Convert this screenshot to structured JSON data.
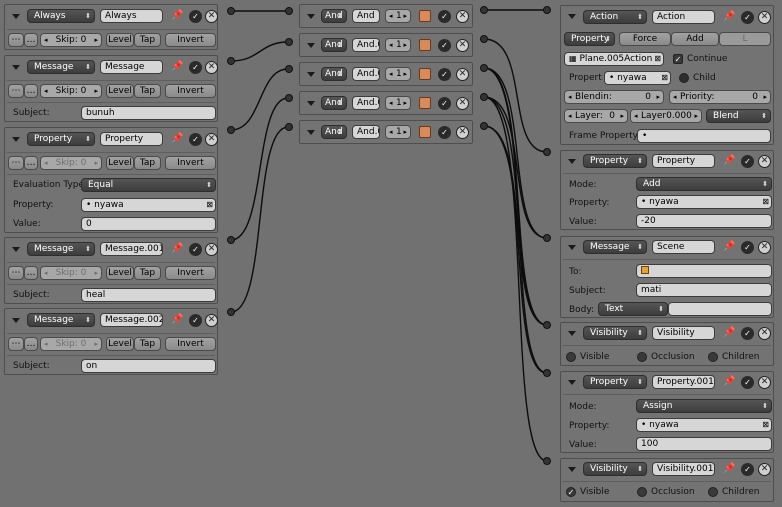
{
  "sensors": [
    {
      "type": "Always",
      "name": "Always",
      "skip_label": "Skip:",
      "skip_value": "0",
      "level": "Level",
      "tap": "Tap",
      "invert": "Invert"
    },
    {
      "type": "Message",
      "name": "Message",
      "skip_label": "Skip:",
      "skip_value": "0",
      "level": "Level",
      "tap": "Tap",
      "invert": "Invert",
      "subject_label": "Subject:",
      "subject": "bunuh"
    },
    {
      "type": "Property",
      "name": "Property",
      "skip_label": "Skip:",
      "skip_value": "0",
      "level": "Level",
      "tap": "Tap",
      "invert": "Invert",
      "eval_label": "Evaluation Type:",
      "eval": "Equal",
      "prop_label": "Property:",
      "prop": "nyawa",
      "value_label": "Value:",
      "value": "0"
    },
    {
      "type": "Message",
      "name": "Message.001",
      "skip_label": "Skip:",
      "skip_value": "0",
      "level": "Level",
      "tap": "Tap",
      "invert": "Invert",
      "subject_label": "Subject:",
      "subject": "heal"
    },
    {
      "type": "Message",
      "name": "Message.002",
      "skip_label": "Skip:",
      "skip_value": "0",
      "level": "Level",
      "tap": "Tap",
      "invert": "Invert",
      "subject_label": "Subject:",
      "subject": "on"
    }
  ],
  "controllers": [
    {
      "type": "And",
      "name": "And",
      "state": "1"
    },
    {
      "type": "And",
      "name": "And.0",
      "state": "1"
    },
    {
      "type": "And",
      "name": "And.0",
      "state": "1"
    },
    {
      "type": "And",
      "name": "And.0",
      "state": "1"
    },
    {
      "type": "And",
      "name": "And.0",
      "state": "1"
    }
  ],
  "actuators": {
    "action": {
      "type": "Action",
      "name": "Action",
      "mode": "Property",
      "force": "Force",
      "add": "Add",
      "l": "L",
      "action_name": "Plane.005Action",
      "continue": "Continue",
      "prop_label": "Propert",
      "prop": "nyawa",
      "child": "Child",
      "blendin_label": "Blendin:",
      "blendin": "0",
      "priority_label": "Priority:",
      "priority": "0",
      "layer_label": "Layer:",
      "layer": "0",
      "layer_weight": "Layer0.000",
      "blend": "Blend",
      "frame_prop_label": "Frame Property:"
    },
    "property1": {
      "type": "Property",
      "name": "Property",
      "mode_label": "Mode:",
      "mode": "Add",
      "prop_label": "Property:",
      "prop": "nyawa",
      "value_label": "Value:",
      "value": "-20"
    },
    "message": {
      "type": "Message",
      "name": "Scene",
      "to_label": "To:",
      "subject_label": "Subject:",
      "subject": "mati",
      "body_label": "Body:",
      "body": "Text"
    },
    "visibility1": {
      "type": "Visibility",
      "name": "Visibility",
      "visible": "Visible",
      "occlusion": "Occlusion",
      "children": "Children"
    },
    "property2": {
      "type": "Property",
      "name": "Property.001",
      "mode_label": "Mode:",
      "mode": "Assign",
      "prop_label": "Property:",
      "prop": "nyawa",
      "value_label": "Value:",
      "value": "100"
    },
    "visibility2": {
      "type": "Visibility",
      "name": "Visibility.001",
      "visible": "Visible",
      "occlusion": "Occlusion",
      "children": "Children"
    }
  },
  "icons": {
    "pin": "pin-icon",
    "check": "check-icon",
    "close": "close-icon",
    "state": "state-icon",
    "object": "object-icon"
  },
  "colors": {
    "background": "#717171",
    "panel": "#737373",
    "menu": "#464646",
    "field": "#d6d6d6",
    "wire": "#0d0d0d"
  }
}
